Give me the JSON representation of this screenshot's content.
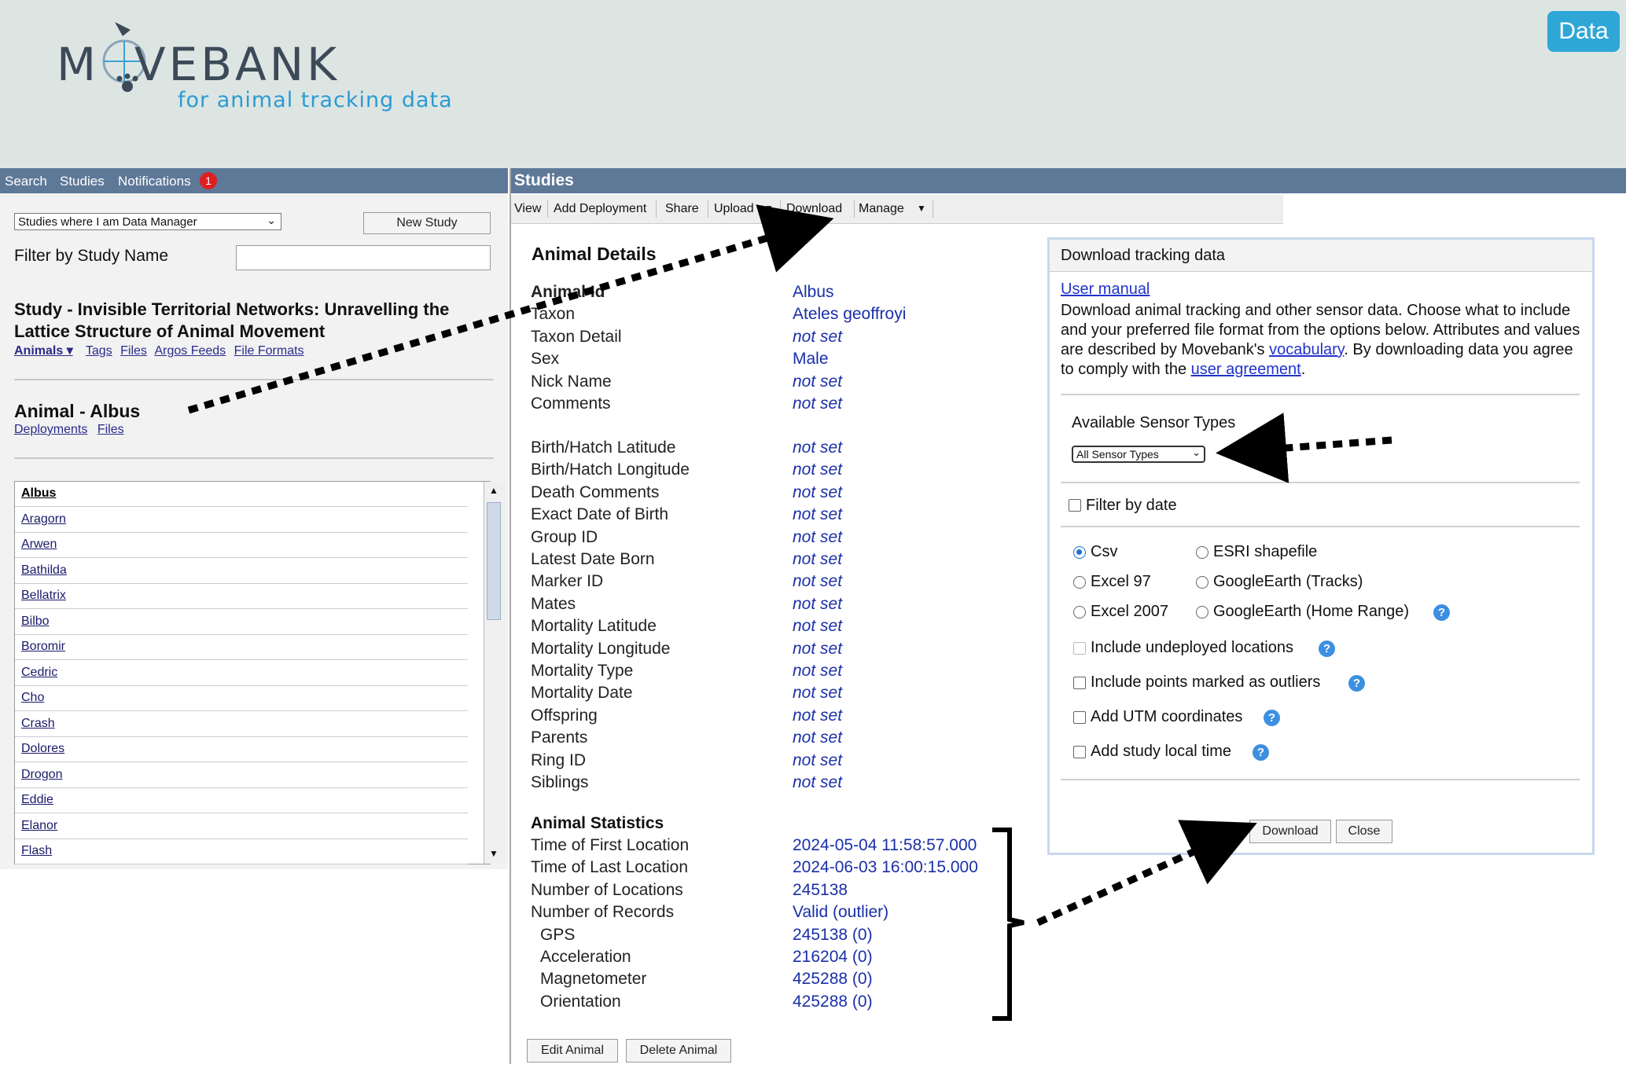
{
  "header": {
    "logo_text": "M  VEBANK",
    "tagline": "for animal tracking data",
    "data_button": "Data"
  },
  "left_nav": {
    "search": "Search",
    "studies": "Studies",
    "notifications": "Notifications",
    "notification_count": "1"
  },
  "studies_bar": {
    "title": "Studies"
  },
  "left_panel": {
    "study_filter_select": "Studies where I am Data Manager",
    "new_study_button": "New Study",
    "filter_label": "Filter by Study Name",
    "filter_value": "",
    "study_title": "Study - Invisible Territorial Networks: Unravelling the Lattice Structure of Animal Movement",
    "study_links": [
      "Animals ▾",
      "Tags",
      "Files",
      "Argos Feeds",
      "File Formats"
    ],
    "animal_title": "Animal - Albus",
    "animal_links": [
      "Deployments",
      "Files"
    ],
    "animals": [
      "Albus",
      "Aragorn",
      "Arwen",
      "Bathilda",
      "Bellatrix",
      "Bilbo",
      "Boromir",
      "Cedric",
      "Cho",
      "Crash",
      "Dolores",
      "Drogon",
      "Eddie",
      "Elanor",
      "Flash"
    ]
  },
  "toolbar": {
    "view": "View",
    "add_deployment": "Add Deployment",
    "share": "Share",
    "upload": "Upload",
    "download": "Download",
    "manage": "Manage"
  },
  "animal_details": {
    "heading": "Animal Details",
    "rows": [
      {
        "label": "Animal Id",
        "value": "Albus"
      },
      {
        "label": "Taxon",
        "value": "Ateles geoffroyi"
      },
      {
        "label": "Taxon Detail",
        "value": "not set"
      },
      {
        "label": "Sex",
        "value": "Male"
      },
      {
        "label": "Nick Name",
        "value": "not set"
      },
      {
        "label": "Comments",
        "value": "not set"
      }
    ],
    "rows2": [
      {
        "label": "Birth/Hatch Latitude",
        "value": "not set"
      },
      {
        "label": "Birth/Hatch Longitude",
        "value": "not set"
      },
      {
        "label": "Death Comments",
        "value": "not set"
      },
      {
        "label": "Exact Date of Birth",
        "value": "not set"
      },
      {
        "label": "Group ID",
        "value": "not set"
      },
      {
        "label": "Latest Date Born",
        "value": "not set"
      },
      {
        "label": "Marker ID",
        "value": "not set"
      },
      {
        "label": "Mates",
        "value": "not set"
      },
      {
        "label": "Mortality Latitude",
        "value": "not set"
      },
      {
        "label": "Mortality Longitude",
        "value": "not set"
      },
      {
        "label": "Mortality Type",
        "value": "not set"
      },
      {
        "label": "Mortality Date",
        "value": "not set"
      },
      {
        "label": "Offspring",
        "value": "not set"
      },
      {
        "label": "Parents",
        "value": "not set"
      },
      {
        "label": "Ring ID",
        "value": "not set"
      },
      {
        "label": "Siblings",
        "value": "not set"
      }
    ]
  },
  "animal_statistics": {
    "heading": "Animal Statistics",
    "rows": [
      {
        "label": "Time of First Location",
        "value": "2024-05-04 11:58:57.000"
      },
      {
        "label": "Time of Last Location",
        "value": "2024-06-03 16:00:15.000"
      },
      {
        "label": "Number of Locations",
        "value": "245138"
      },
      {
        "label": "Number of Records",
        "value": "Valid (outlier)"
      },
      {
        "label": "GPS",
        "value": "245138 (0)"
      },
      {
        "label": "Acceleration",
        "value": "216204 (0)"
      },
      {
        "label": "Magnetometer",
        "value": "425288 (0)"
      },
      {
        "label": "Orientation",
        "value": "425288 (0)"
      }
    ],
    "edit_button": "Edit Animal",
    "delete_button": "Delete Animal"
  },
  "download_panel": {
    "title": "Download tracking data",
    "user_manual": "User manual",
    "desc_part1": "Download animal tracking and other sensor data. Choose what to include and your preferred file format from the options below. Attributes and values are described by Movebank's ",
    "vocabulary_link": "vocabulary",
    "desc_part2": ". By downloading data you agree to comply with the ",
    "agreement_link": "user agreement",
    "desc_part3": ".",
    "sensor_label": "Available Sensor Types",
    "sensor_select": "All Sensor Types",
    "filter_by_date": "Filter by date",
    "formats": [
      "Csv",
      "ESRI shapefile",
      "Excel 97",
      "GoogleEarth (Tracks)",
      "Excel 2007",
      "GoogleEarth (Home Range)"
    ],
    "selected_format": "Csv",
    "options": [
      "Include undeployed locations",
      "Include points marked as outliers",
      "Add UTM coordinates",
      "Add study local time"
    ],
    "download_button": "Download",
    "close_button": "Close"
  }
}
